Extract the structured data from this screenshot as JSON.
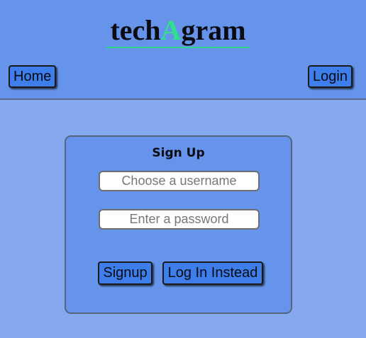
{
  "header": {
    "logo": {
      "prefix": "tech",
      "accent": "A",
      "suffix": "gram"
    },
    "home_label": "Home",
    "login_label": "Login"
  },
  "signup_form": {
    "title": "Sign Up",
    "username": {
      "value": "",
      "placeholder": "Choose a username"
    },
    "password": {
      "value": "",
      "placeholder": "Enter a password"
    },
    "signup_label": "Signup",
    "login_instead_label": "Log In Instead"
  },
  "colors": {
    "page_background": "#85a8ef",
    "header_background": "#6594ea",
    "button_fill": "#3d7eea",
    "logo_accent": "#2fe08f"
  }
}
